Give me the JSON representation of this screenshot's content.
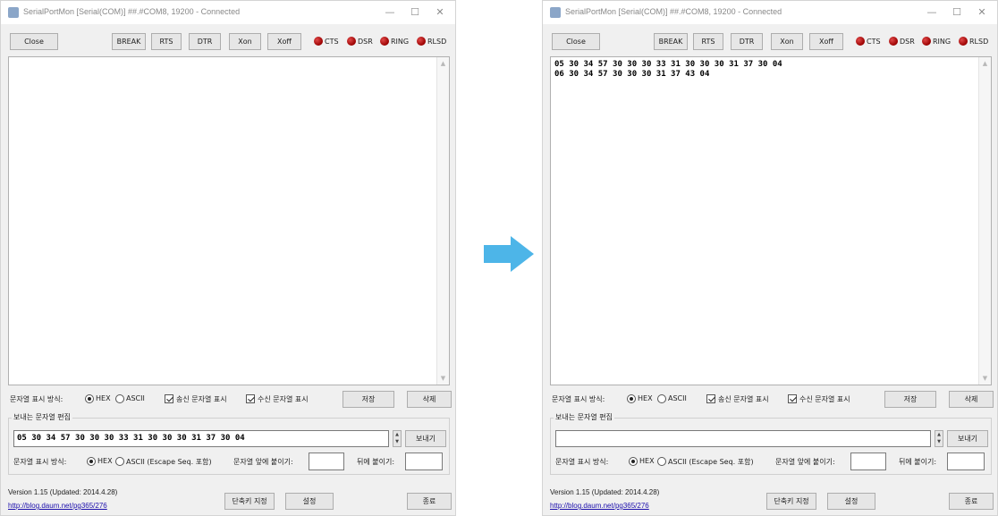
{
  "left": {
    "window": {
      "title": "SerialPortMon [Serial(COM)] ##.#COM8, 19200 - Connected"
    },
    "terminal": {
      "text": ""
    },
    "send": {
      "value": "05 30 34 57 30 30 30 33 31 30 30 30 31 37 30 04"
    }
  },
  "right": {
    "window": {
      "title": "SerialPortMon [Serial(COM)] ##.#COM8, 19200 - Connected"
    },
    "terminal": {
      "text": "05 30 34 57 30 30 30 33 31 30 30 30 31 37 30 04\n06 30 34 57 30 30 30 31 37 43 04"
    },
    "send": {
      "value": ""
    }
  },
  "labels": {
    "close": "Close",
    "break": "BREAK",
    "rts": "RTS",
    "dtr": "DTR",
    "xon": "Xon",
    "xoff": "Xoff",
    "cts": "CTS",
    "dsr": "DSR",
    "ring": "RING",
    "rlsd": "RLSD",
    "display_mode": "문자열 표시 방식:",
    "hex": "HEX",
    "ascii": "ASCII",
    "show_sent": "송신 문자열 표시",
    "show_recv": "수신 문자열 표시",
    "save": "저장",
    "delete": "삭제",
    "send_group": "보내는 문자열 편집",
    "send_btn": "보내기",
    "ascii_escape": "ASCII (Escape Seq. 포함)",
    "prefix": "문자열 앞에 붙이기:",
    "suffix": "뒤에 붙이기:",
    "version": "Version 1.15 (Updated: 2014.4.28)",
    "url": "http://blog.daum.net/pg365/276",
    "shortcut": "단축키 지정",
    "settings": "설정",
    "exit": "종료"
  },
  "window_controls": {
    "minimize": "—",
    "maximize": "☐",
    "close": "✕"
  },
  "icons": {
    "scroll_up": "▲",
    "scroll_down": "▼",
    "spin_up": "▲",
    "spin_down": "▼"
  },
  "colors": {
    "led": "#b00000",
    "arrow": "#4db5e8",
    "link": "#1a0dab"
  }
}
